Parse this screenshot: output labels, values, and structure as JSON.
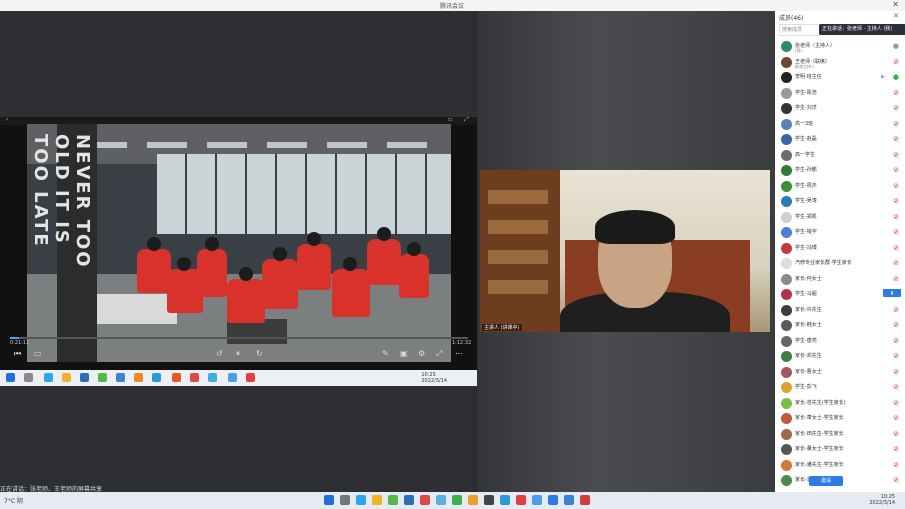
{
  "window": {
    "title": "腾讯会议",
    "close": "✕"
  },
  "share": {
    "time_current": "0:21:11",
    "time_total": "1:12:32",
    "pillar_text": "NEVER TOO OLD IT IS TOO LATE LEARN",
    "progress": 0.02
  },
  "camera": {
    "name_label": "主讲人 (讲课中)"
  },
  "stage_footer": "正在讲话：张老师、王老师的屏幕共享",
  "panel": {
    "title": "成员(46)",
    "search_placeholder": "搜索成员",
    "speaking_label": "正在讲话：张老师 · 主持人 (我)",
    "invite_label": "邀请",
    "participants": [
      {
        "name": "张老师（主持人）",
        "sub": "(我)",
        "color": "#2a8c6e",
        "status": "host"
      },
      {
        "name": "王老师（联席）",
        "sub": "联席主持人",
        "color": "#6b4a2e",
        "status": "muted"
      },
      {
        "name": "李明-班主任",
        "sub": "",
        "color": "#222222",
        "status": "active"
      },
      {
        "name": "学生-陈浩",
        "sub": "",
        "color": "#9a9a9a",
        "status": "muted"
      },
      {
        "name": "学生-刘洋",
        "sub": "",
        "color": "#333333",
        "status": "muted"
      },
      {
        "name": "高一3班",
        "sub": "",
        "color": "#5c7fb5",
        "status": "muted"
      },
      {
        "name": "学生-赵磊",
        "sub": "",
        "color": "#3a66a8",
        "status": "muted"
      },
      {
        "name": "高一学生",
        "sub": "",
        "color": "#6d6d6d",
        "status": "muted"
      },
      {
        "name": "学生-孙鹏",
        "sub": "",
        "color": "#2e7d32",
        "status": "muted"
      },
      {
        "name": "学生-周杰",
        "sub": "",
        "color": "#3b8f3b",
        "status": "muted"
      },
      {
        "name": "学生-吴涛",
        "sub": "",
        "color": "#2b7bb9",
        "status": "muted"
      },
      {
        "name": "学生-郑凯",
        "sub": "",
        "color": "#cfcfcf",
        "status": "muted"
      },
      {
        "name": "学生-钱宇",
        "sub": "",
        "color": "#4b7fd1",
        "status": "muted"
      },
      {
        "name": "学生-冯博",
        "sub": "",
        "color": "#c23a3a",
        "status": "muted"
      },
      {
        "name": "汽修专业家长群-学生家长",
        "sub": "",
        "color": "#dddddd",
        "status": "muted"
      },
      {
        "name": "家长-何女士",
        "sub": "",
        "color": "#8a8a8a",
        "status": "muted"
      },
      {
        "name": "学生-马超",
        "sub": "",
        "color": "#b5304a",
        "status": "raised"
      },
      {
        "name": "家长-许先生",
        "sub": "",
        "color": "#3c3c3c",
        "status": "muted"
      },
      {
        "name": "家长-韩女士",
        "sub": "",
        "color": "#5a5a5a",
        "status": "muted"
      },
      {
        "name": "学生-唐亮",
        "sub": "",
        "color": "#666666",
        "status": "muted"
      },
      {
        "name": "家长-邓先生",
        "sub": "",
        "color": "#3f7d3f",
        "status": "muted"
      },
      {
        "name": "家长-曹女士",
        "sub": "",
        "color": "#a05a5a",
        "status": "muted"
      },
      {
        "name": "学生-彭飞",
        "sub": "",
        "color": "#e0a030",
        "status": "muted"
      },
      {
        "name": "家长-曾先生(学生家长)",
        "sub": "",
        "color": "#7bc043",
        "status": "muted"
      },
      {
        "name": "家长-萧女士-学生家长",
        "sub": "",
        "color": "#c25a3a",
        "status": "muted"
      },
      {
        "name": "家长-田先生-学生家长",
        "sub": "",
        "color": "#9c6b4e",
        "status": "muted"
      },
      {
        "name": "家长-董女士-学生家长",
        "sub": "",
        "color": "#555555",
        "status": "muted"
      },
      {
        "name": "家长-潘先生-学生家长",
        "sub": "",
        "color": "#d4763b",
        "status": "muted"
      },
      {
        "name": "家长-袁女士-学生家长",
        "sub": "",
        "color": "#4a8c4a",
        "status": "muted"
      }
    ]
  },
  "taskbar": {
    "weather": "7°C 阴",
    "time": "10:25",
    "date": "2022/3/14"
  },
  "colors": {
    "accent": "#2d7be5",
    "muted": "#e23b3b"
  }
}
